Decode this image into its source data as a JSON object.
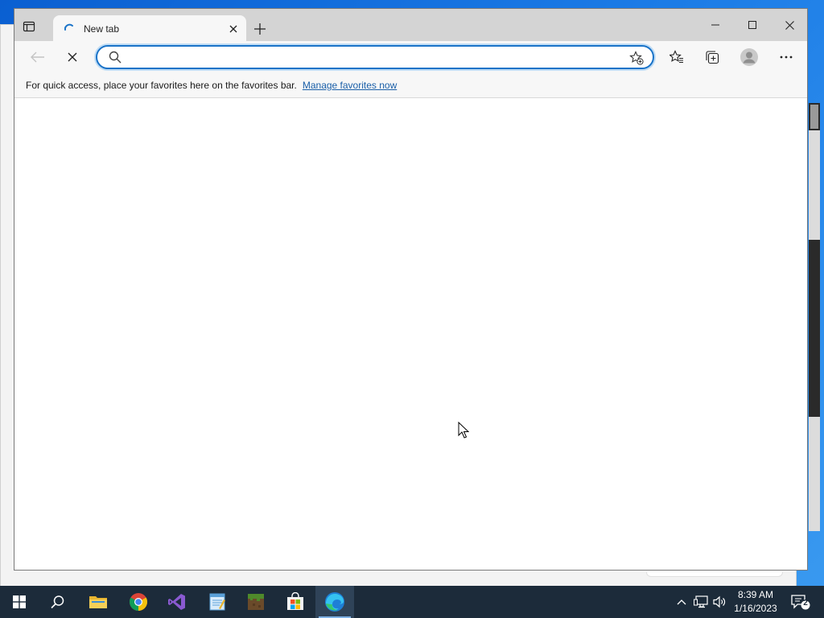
{
  "browser": {
    "tab": {
      "title": "New tab"
    },
    "address": {
      "value": "",
      "placeholder": ""
    },
    "favorites_bar": {
      "message": "For quick access, place your favorites here on the favorites bar.",
      "link": "Manage favorites now"
    }
  },
  "taskbar": {
    "apps": [
      "start-icon",
      "search-icon",
      "file-explorer-icon",
      "chrome-icon",
      "visual-studio-icon",
      "notepad-icon",
      "minecraft-icon",
      "store-icon",
      "edge-icon"
    ],
    "active_app": "edge-icon",
    "clock": {
      "time": "8:39 AM",
      "date": "1/16/2023"
    },
    "notification_count": "2"
  },
  "colors": {
    "accent": "#1a73c8",
    "taskbar": "#1c2b3a",
    "desktop": "#1b7be6"
  }
}
